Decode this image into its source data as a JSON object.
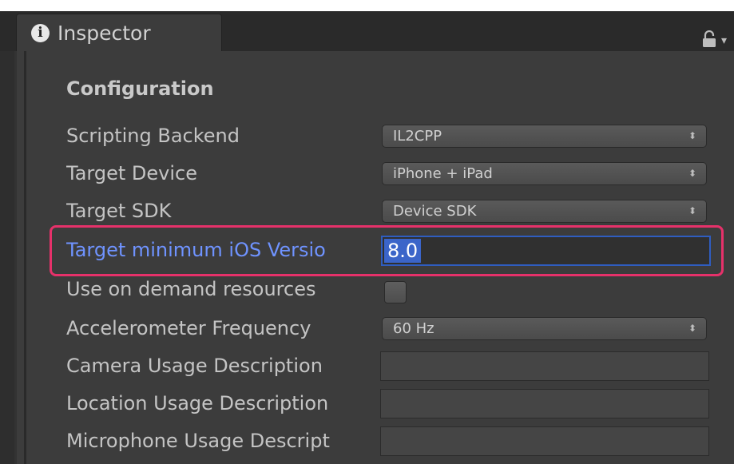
{
  "tab": {
    "title": "Inspector",
    "icon": "info-icon"
  },
  "section": {
    "title": "Configuration"
  },
  "rows": [
    {
      "label": "Scripting Backend",
      "value": "IL2CPP"
    },
    {
      "label": "Target Device",
      "value": "iPhone + iPad"
    },
    {
      "label": "Target SDK",
      "value": "Device SDK"
    },
    {
      "label": "Target minimum iOS Versio",
      "value": "8.0"
    },
    {
      "label": "Use on demand resources"
    },
    {
      "label": "Accelerometer Frequency",
      "value": "60 Hz"
    },
    {
      "label": "Camera Usage Description",
      "value": ""
    },
    {
      "label": "Location Usage Description",
      "value": ""
    },
    {
      "label": "Microphone Usage Descript",
      "value": ""
    }
  ],
  "dropdown_arrows": "⬍",
  "colors": {
    "highlight": "#e6316a",
    "focus_label": "#6f93ff",
    "selection": "#3b65c9"
  }
}
